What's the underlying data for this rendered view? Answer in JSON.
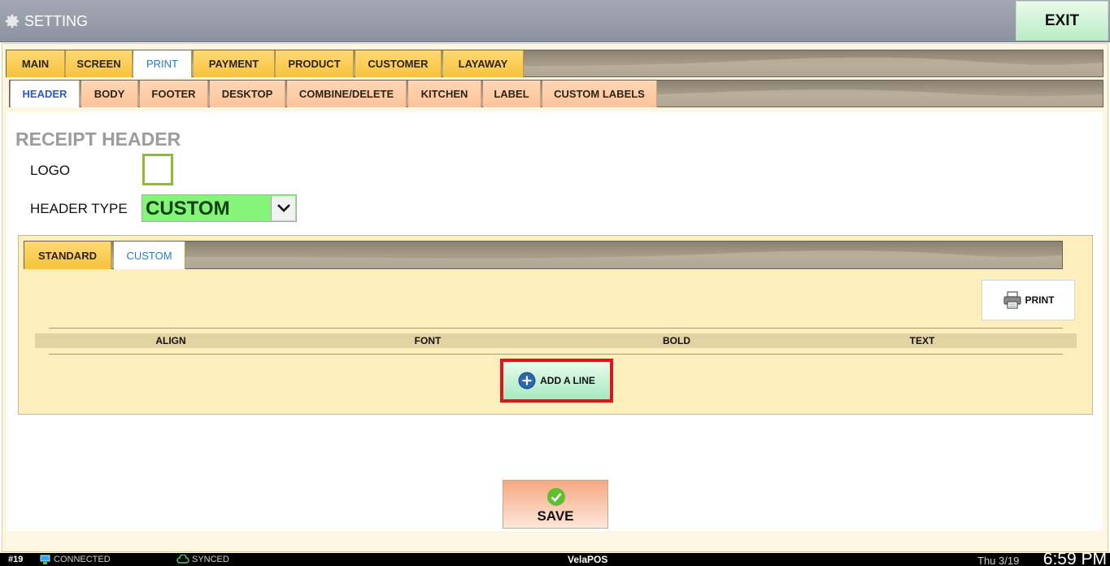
{
  "window": {
    "title": "SETTING",
    "exit_label": "EXIT"
  },
  "main_tabs": [
    {
      "label": "MAIN"
    },
    {
      "label": "SCREEN"
    },
    {
      "label": "PRINT",
      "active": true
    },
    {
      "label": "PAYMENT"
    },
    {
      "label": "PRODUCT"
    },
    {
      "label": "CUSTOMER"
    },
    {
      "label": "LAYAWAY"
    }
  ],
  "sub_tabs": [
    {
      "label": "HEADER",
      "active": true
    },
    {
      "label": "BODY"
    },
    {
      "label": "FOOTER"
    },
    {
      "label": "DESKTOP"
    },
    {
      "label": "COMBINE/DELETE"
    },
    {
      "label": "KITCHEN"
    },
    {
      "label": "LABEL"
    },
    {
      "label": "CUSTOM LABELS"
    }
  ],
  "receipt_header": {
    "title": "RECEIPT HEADER",
    "logo_label": "LOGO",
    "logo_checked": false,
    "header_type_label": "HEADER TYPE",
    "header_type_value": "CUSTOM"
  },
  "header_tabs": [
    {
      "label": "STANDARD"
    },
    {
      "label": "CUSTOM",
      "active": true
    }
  ],
  "custom_panel": {
    "print_label": "PRINT",
    "columns": [
      "ALIGN",
      "FONT",
      "BOLD",
      "TEXT"
    ],
    "add_line_label": "ADD A LINE"
  },
  "save_label": "SAVE",
  "status_bar": {
    "station": "#19",
    "connection": "CONNECTED",
    "sync": "SYNCED",
    "app_name": "VelaPOS",
    "date": "Thu 3/19",
    "time": "6:59 PM"
  },
  "colors": {
    "accent_green": "#85f57a",
    "highlight_red": "#e01515",
    "tab_yellow": "#f7c33d",
    "tab_peach": "#fbc39b"
  }
}
